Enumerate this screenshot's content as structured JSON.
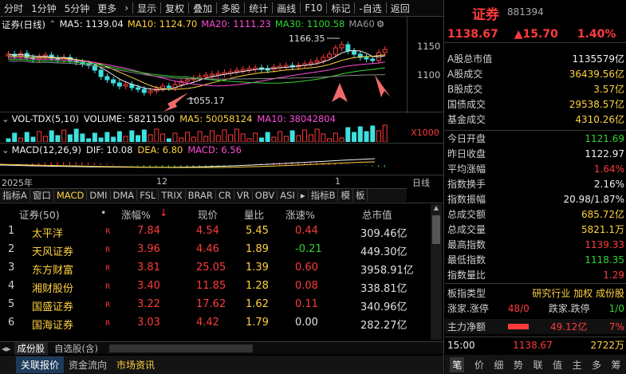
{
  "toolbar": {
    "items": [
      "分时",
      "1分钟",
      "5分钟",
      "更多"
    ],
    "chevron": "chevron-right-icon",
    "buttons": [
      "显示",
      "复权",
      "叠加",
      "多股",
      "统计",
      "画线",
      "F10",
      "标记",
      "-自选",
      "返回"
    ]
  },
  "main_chart": {
    "title": "证券(日线)",
    "ma": [
      {
        "label": "MA5: 1139.04",
        "color": "#f0f0f0"
      },
      {
        "label": "MA10: 1124.70",
        "color": "#ffd23f"
      },
      {
        "label": "MA20: 1111.23",
        "color": "#ff4bd8"
      },
      {
        "label": "MA30: 1100.58",
        "color": "#33d433"
      },
      {
        "label": "MA60",
        "color": "#9a9a9a"
      }
    ],
    "price_axis": [
      "1150",
      "1100"
    ],
    "high_label": "1166.35",
    "low_label": "1055.17"
  },
  "volume": {
    "title": "VOL-TDX(5,10)",
    "volume": "VOLUME: 58211500",
    "ma5": "MA5: 50058124",
    "ma10": "MA10: 38042804",
    "scale": "X1000"
  },
  "macd": {
    "title": "MACD(12,26,9)",
    "dif": "DIF: 10.08",
    "dea": "DEA: 6.80",
    "macd": "MACD: 6.56"
  },
  "date_axis": {
    "year": "2025年",
    "month": "12",
    "one": "1",
    "period": "日线"
  },
  "indicator_tabs": [
    "指标A",
    "窗口",
    "MACD",
    "DMI",
    "DMA",
    "FSL",
    "TRIX",
    "BRAR",
    "CR",
    "VR",
    "OBV",
    "ASI",
    "指标B",
    "模",
    "板"
  ],
  "list": {
    "headers": {
      "name": "证券(50)",
      "dot": "•",
      "change": "涨幅%",
      "arrow": "↓",
      "price": "现价",
      "vol_ratio": "量比",
      "speed": "涨速%",
      "mcap": "总市值"
    },
    "rows": [
      {
        "no": "1",
        "name": "太平洋",
        "flag": "R",
        "change": "7.84",
        "price": "4.54",
        "vol_ratio": "5.45",
        "speed": "0.44",
        "mcap": "309.46亿"
      },
      {
        "no": "2",
        "name": "天风证券",
        "flag": "R",
        "change": "3.96",
        "price": "4.46",
        "vol_ratio": "1.89",
        "speed": "-0.21",
        "mcap": "449.30亿"
      },
      {
        "no": "3",
        "name": "东方财富",
        "flag": "R",
        "change": "3.81",
        "price": "25.05",
        "vol_ratio": "1.39",
        "speed": "0.60",
        "mcap": "3958.91亿"
      },
      {
        "no": "4",
        "name": "湘财股份",
        "flag": "R",
        "change": "3.40",
        "price": "11.85",
        "vol_ratio": "1.28",
        "speed": "0.08",
        "mcap": "338.81亿"
      },
      {
        "no": "5",
        "name": "国盛证券",
        "flag": "R",
        "change": "3.22",
        "price": "17.62",
        "vol_ratio": "1.62",
        "speed": "0.11",
        "mcap": "340.96亿"
      },
      {
        "no": "6",
        "name": "国海证券",
        "flag": "R",
        "change": "3.03",
        "price": "4.42",
        "vol_ratio": "1.79",
        "speed": "0.00",
        "mcap": "282.27亿"
      }
    ]
  },
  "bottom_tabs": [
    "成份股",
    "自选股(含)"
  ],
  "footer_tabs": [
    "关联报价",
    "资金流向",
    "市场资讯"
  ],
  "right": {
    "name": "证券",
    "code": "881394",
    "price": "1138.67",
    "change": "▲15.70",
    "pct": "1.40%",
    "stats1": [
      {
        "k": "A股总市值",
        "v": "1135579亿",
        "c": "white"
      },
      {
        "k": "A股成交",
        "v": "36439.56亿",
        "c": "yellow"
      },
      {
        "k": "B股成交",
        "v": "3.57亿",
        "c": "yellow"
      },
      {
        "k": "国债成交",
        "v": "29538.57亿",
        "c": "yellow"
      },
      {
        "k": "基金成交",
        "v": "4310.26亿",
        "c": "yellow"
      }
    ],
    "stats2": [
      {
        "k": "今日开盘",
        "v": "1121.69",
        "c": "green"
      },
      {
        "k": "昨日收盘",
        "v": "1122.97",
        "c": "white"
      },
      {
        "k": "平均涨幅",
        "v": "1.64%",
        "c": "red"
      },
      {
        "k": "指数换手",
        "v": "2.16%",
        "c": "white"
      },
      {
        "k": "指数振幅",
        "v": "20.98/1.87%",
        "c": "white"
      },
      {
        "k": "总成交额",
        "v": "685.72亿",
        "c": "yellow"
      },
      {
        "k": "总成交量",
        "v": "5821.1万",
        "c": "yellow"
      },
      {
        "k": "最高指数",
        "v": "1139.33",
        "c": "red"
      },
      {
        "k": "最低指数",
        "v": "1118.35",
        "c": "green"
      },
      {
        "k": "指数量比",
        "v": "1.29",
        "c": "red"
      }
    ],
    "sector": {
      "k": "板指类型",
      "v": "研究行业 加权 成份股"
    },
    "limits": {
      "k": "涨家.涨停",
      "up": "48/0",
      "k2": "跌家.跌停",
      "down": "1/0"
    },
    "flow": {
      "k": "主力净额",
      "v": "49.12亿",
      "p": "7%"
    },
    "tick": {
      "time": "15:00",
      "price": "1138.67",
      "vol": "2722万"
    },
    "bottom_tabs": [
      "笔",
      "价",
      "细",
      "势",
      "联",
      "值",
      "主",
      "多",
      "筹"
    ]
  }
}
